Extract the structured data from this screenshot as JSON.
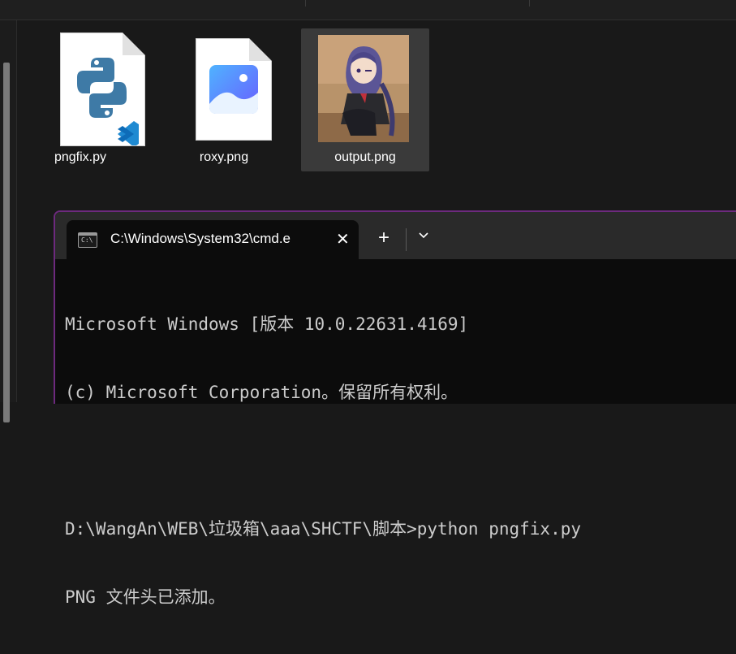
{
  "explorer": {
    "files": [
      {
        "name": "pngfix.py",
        "icon": "python-file-icon",
        "selected": false
      },
      {
        "name": "roxy.png",
        "icon": "image-file-icon",
        "selected": false
      },
      {
        "name": "output.png",
        "icon": "image-thumbnail",
        "selected": true
      }
    ]
  },
  "terminal": {
    "tab_title": "C:\\Windows\\System32\\cmd.e",
    "close_glyph": "✕",
    "new_tab_glyph": "+",
    "lines": [
      "Microsoft Windows [版本 10.0.22631.4169]",
      "(c) Microsoft Corporation。保留所有权利。",
      "",
      "D:\\WangAn\\WEB\\垃圾箱\\aaa\\SHCTF\\脚本>python pngfix.py",
      "PNG 文件头已添加。"
    ]
  },
  "colors": {
    "background": "#191919",
    "terminal_border": "#6d2a7e",
    "python_blue": "#3e7aa6",
    "python_yellow": "#3e7aa6",
    "vscode_blue": "#1f8ad2",
    "image_icon_blue": "#2f8cff"
  }
}
